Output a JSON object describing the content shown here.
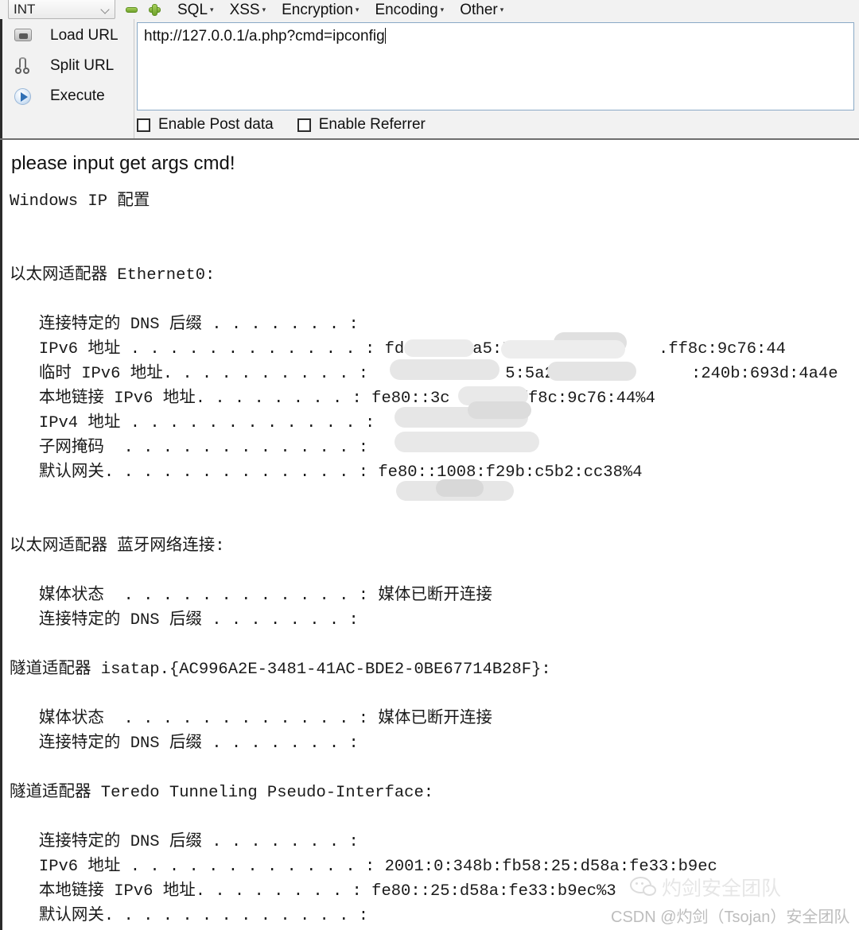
{
  "toolbar": {
    "mode_select": {
      "value": "INT",
      "icon": "chevron-down-icon"
    },
    "buttons": {
      "minus": "−",
      "plus": "+"
    },
    "menus": [
      {
        "label": "SQL",
        "caret": "▾"
      },
      {
        "label": "XSS",
        "caret": "▾"
      },
      {
        "label": "Encryption",
        "caret": "▾"
      },
      {
        "label": "Encoding",
        "caret": "▾"
      },
      {
        "label": "Other",
        "caret": "▾"
      }
    ],
    "actions": [
      {
        "label": "Load URL",
        "icon": "load-url-icon"
      },
      {
        "label": "Split URL",
        "icon": "scissors-icon"
      },
      {
        "label": "Execute",
        "icon": "play-icon"
      }
    ],
    "url_field": {
      "value": "http://127.0.0.1/a.php?cmd=ipconfig",
      "placeholder": ""
    },
    "checkboxes": [
      {
        "label": "Enable Post data",
        "checked": false
      },
      {
        "label": "Enable Referrer",
        "checked": false
      }
    ]
  },
  "page": {
    "headline": "please input get args cmd!",
    "command_output": "Windows IP 配置\n\n\n以太网适配器 Ethernet0:\n\n   连接特定的 DNS 后缀 . . . . . . . :\n   IPv6 地址 . . . . . . . . . . . . : fd15  4  a5:5a2b:1          .ff8c:9c76:44\n   临时 IPv6 地址. . . . . . . . . . :              5:5a2b:            :240b:693d:4a4e\n   本地链接 IPv6 地址. . . . . . . . : fe80::3c  17   ff8c:9c76:44%4\n   IPv4 地址 . . . . . . . . . . . . :\n   子网掩码  . . . . . . . . . . . . :\n   默认网关. . . . . . . . . . . . . : fe80::1008:f29b:c5b2:cc38%4\n\n\n以太网适配器 蓝牙网络连接:\n\n   媒体状态  . . . . . . . . . . . . : 媒体已断开连接\n   连接特定的 DNS 后缀 . . . . . . . :\n\n隧道适配器 isatap.{AC996A2E-3481-41AC-BDE2-0BE67714B28F}:\n\n   媒体状态  . . . . . . . . . . . . : 媒体已断开连接\n   连接特定的 DNS 后缀 . . . . . . . :\n\n隧道适配器 Teredo Tunneling Pseudo-Interface:\n\n   连接特定的 DNS 后缀 . . . . . . . :\n   IPv6 地址 . . . . . . . . . . . . : 2001:0:348b:fb58:25:d58a:fe33:b9ec\n   本地链接 IPv6 地址. . . . . . . . : fe80::25:d58a:fe33:b9ec%3\n   默认网关. . . . . . . . . . . . . :"
  },
  "watermarks": {
    "logo_text": "灼剑安全团队",
    "logo_icon": "wechat-icon",
    "csdn_text": "CSDN @灼剑（Tsojan）安全团队"
  }
}
